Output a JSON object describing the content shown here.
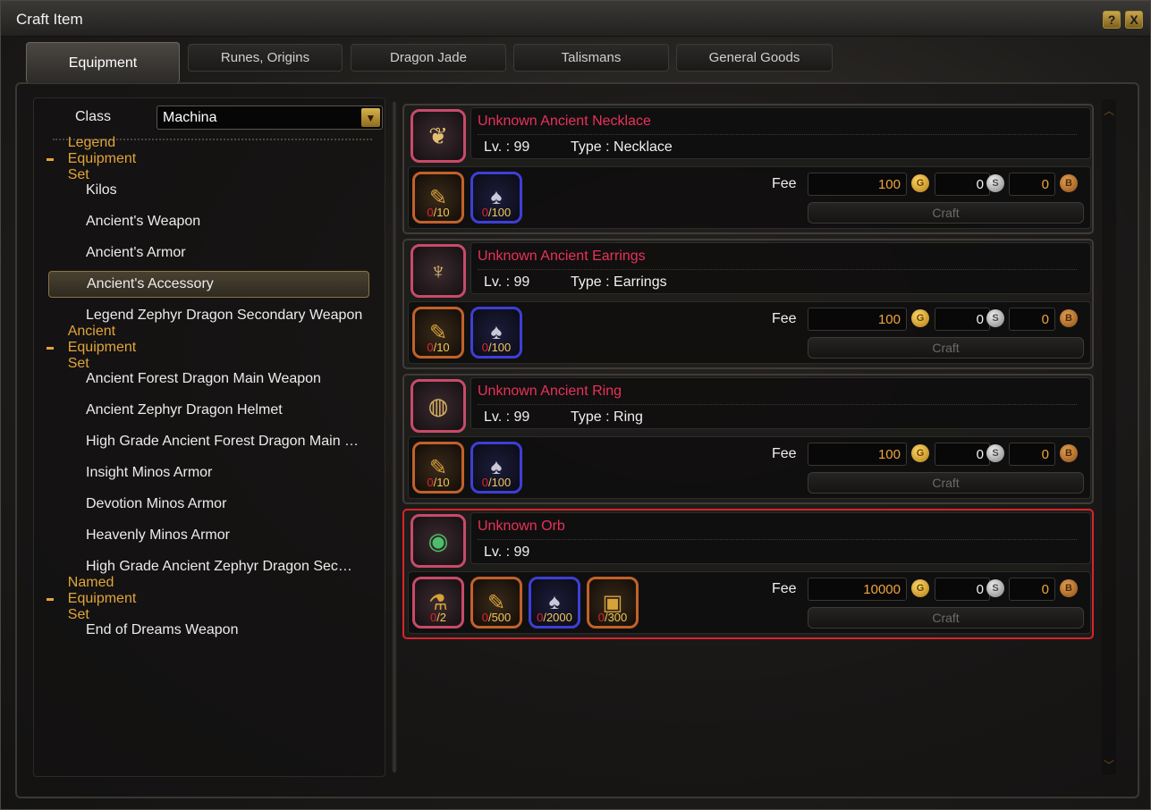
{
  "window": {
    "title": "Craft Item",
    "help_icon": "?",
    "close_icon": "X"
  },
  "tabs": [
    {
      "label": "Equipment",
      "active": true
    },
    {
      "label": "Runes, Origins",
      "active": false
    },
    {
      "label": "Dragon Jade",
      "active": false
    },
    {
      "label": "Talismans",
      "active": false
    },
    {
      "label": "General Goods",
      "active": false
    }
  ],
  "filter": {
    "class_label": "Class",
    "class_value": "Machina"
  },
  "tree": {
    "categories": [
      {
        "label": "Legend Equipment Set"
      },
      {
        "label": "Ancient Equipment Set"
      },
      {
        "label": "Named Equipment Set"
      }
    ],
    "items": [
      "Kilos",
      "Ancient's Weapon",
      "Ancient's Armor",
      "Ancient's Accessory",
      "Legend Zephyr Dragon Secondary Weapon",
      "Ancient Forest Dragon Main Weapon",
      "Ancient Zephyr Dragon Helmet",
      "High Grade Ancient Forest Dragon Main …",
      "Insight Minos Armor",
      "Devotion Minos Armor",
      "Heavenly Minos Armor",
      "High Grade Ancient Zephyr Dragon Sec…",
      "End of Dreams Weapon"
    ],
    "selected_item": "Ancient's Accessory"
  },
  "recipes": [
    {
      "name": "Unknown Ancient Necklace",
      "level": "Lv. : 99",
      "type": "Type : Necklace",
      "icon": "necklace-icon",
      "materials": [
        {
          "icon": "scroll-icon",
          "have": "0",
          "need": "/10",
          "border": "orange"
        },
        {
          "icon": "rune-icon",
          "have": "0",
          "need": "/100",
          "border": "blue"
        }
      ],
      "fee_label": "Fee",
      "gold": "100",
      "silver": "0",
      "bronze": "0",
      "craft_label": "Craft"
    },
    {
      "name": "Unknown Ancient Earrings",
      "level": "Lv. : 99",
      "type": "Type : Earrings",
      "icon": "earrings-icon",
      "materials": [
        {
          "icon": "scroll-icon",
          "have": "0",
          "need": "/10",
          "border": "orange"
        },
        {
          "icon": "rune-icon",
          "have": "0",
          "need": "/100",
          "border": "blue"
        }
      ],
      "fee_label": "Fee",
      "gold": "100",
      "silver": "0",
      "bronze": "0",
      "craft_label": "Craft"
    },
    {
      "name": "Unknown Ancient Ring",
      "level": "Lv. : 99",
      "type": "Type : Ring",
      "icon": "ring-icon",
      "materials": [
        {
          "icon": "scroll-icon",
          "have": "0",
          "need": "/10",
          "border": "orange"
        },
        {
          "icon": "rune-icon",
          "have": "0",
          "need": "/100",
          "border": "blue"
        }
      ],
      "fee_label": "Fee",
      "gold": "100",
      "silver": "0",
      "bronze": "0",
      "craft_label": "Craft"
    },
    {
      "name": "Unknown Orb",
      "level": "Lv. : 99",
      "type": "",
      "icon": "orb-icon",
      "materials": [
        {
          "icon": "potion-icon",
          "have": "0",
          "need": "/2",
          "border": "pink"
        },
        {
          "icon": "scroll-icon",
          "have": "0",
          "need": "/500",
          "border": "orange"
        },
        {
          "icon": "rune-icon",
          "have": "0",
          "need": "/2000",
          "border": "blue"
        },
        {
          "icon": "tablet-icon",
          "have": "0",
          "need": "/300",
          "border": "orange"
        }
      ],
      "fee_label": "Fee",
      "gold": "10000",
      "silver": "0",
      "bronze": "0",
      "craft_label": "Craft"
    }
  ],
  "colors": {
    "category": "#e0a53a",
    "item_name": "#e8325a",
    "gold_value": "#f0a53a",
    "highlight": "#d8242c",
    "quantity_have": "#e0232b"
  }
}
